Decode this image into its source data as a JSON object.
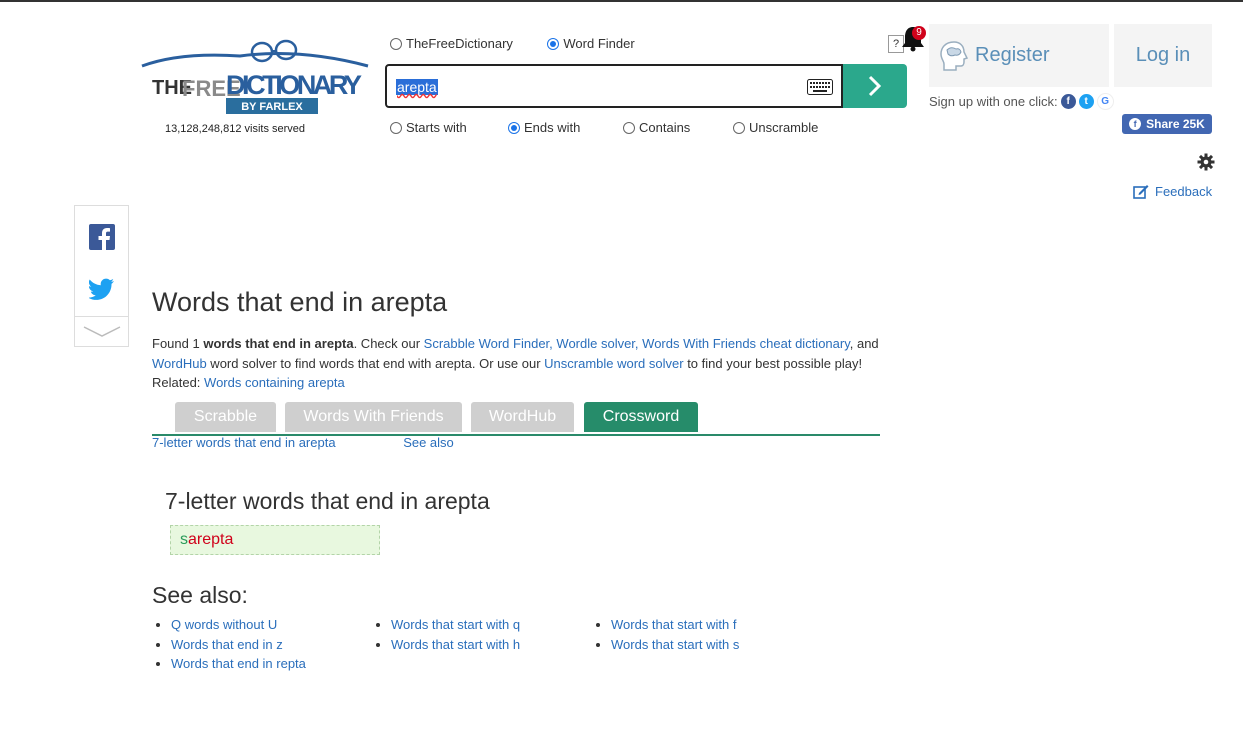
{
  "header": {
    "logo": {
      "line1": "THE",
      "line2": "FREE",
      "line3": "DICTIONARY",
      "byline": "BY FARLEX"
    },
    "visits": "13,128,248,812 visits served",
    "source_options": [
      {
        "label": "TheFreeDictionary",
        "selected": false
      },
      {
        "label": "Word Finder",
        "selected": true
      }
    ],
    "search": {
      "value": "arepta",
      "keyboard_icon": "keyboard-icon",
      "go_icon": "chevron-right-icon"
    },
    "mode_options": [
      {
        "label": "Starts with",
        "selected": false
      },
      {
        "label": "Ends with",
        "selected": true
      },
      {
        "label": "Contains",
        "selected": false
      },
      {
        "label": "Unscramble",
        "selected": false
      }
    ],
    "help": "?",
    "notification_count": "9",
    "register": "Register",
    "login": "Log in",
    "signup_text": "Sign up with one click:",
    "share_label": "Share 25K",
    "feedback": "Feedback",
    "colors": {
      "accent": "#2ba88c",
      "link": "#2a6ebb",
      "tab_active": "#268c6a",
      "tab_inactive": "#cfcfcf"
    }
  },
  "main": {
    "title": "Words that end in arepta",
    "intro": {
      "found": "Found 1 ",
      "bold": "words that end in arepta",
      "t1": ". Check our ",
      "l1": "Scrabble Word Finder",
      "c1": ", ",
      "l2": "Wordle solver",
      "c2": ", ",
      "l3": "Words With Friends cheat dictionary",
      "t2": ", and ",
      "l4": "WordHub",
      "t3": " word solver to find words that end with arepta. Or use our ",
      "l5": "Unscramble word solver",
      "t4": " to find your best possible play!",
      "related_label": "Related: ",
      "related_link": "Words containing arepta"
    },
    "tabs": [
      "Scrabble",
      "Words With Friends",
      "WordHub",
      "Crossword"
    ],
    "sublinks": [
      "7-letter words that end in arepta",
      "See also"
    ],
    "section_title": "7-letter words that end in arepta",
    "result": {
      "prefix": "s",
      "suffix": "arepta"
    },
    "see_also_title": "See also:",
    "see_also": [
      [
        "Q words without U",
        "Words that end in z",
        "Words that end in repta"
      ],
      [
        "Words that start with q",
        "Words that start with h"
      ],
      [
        "Words that start with f",
        "Words that start with s"
      ]
    ]
  }
}
